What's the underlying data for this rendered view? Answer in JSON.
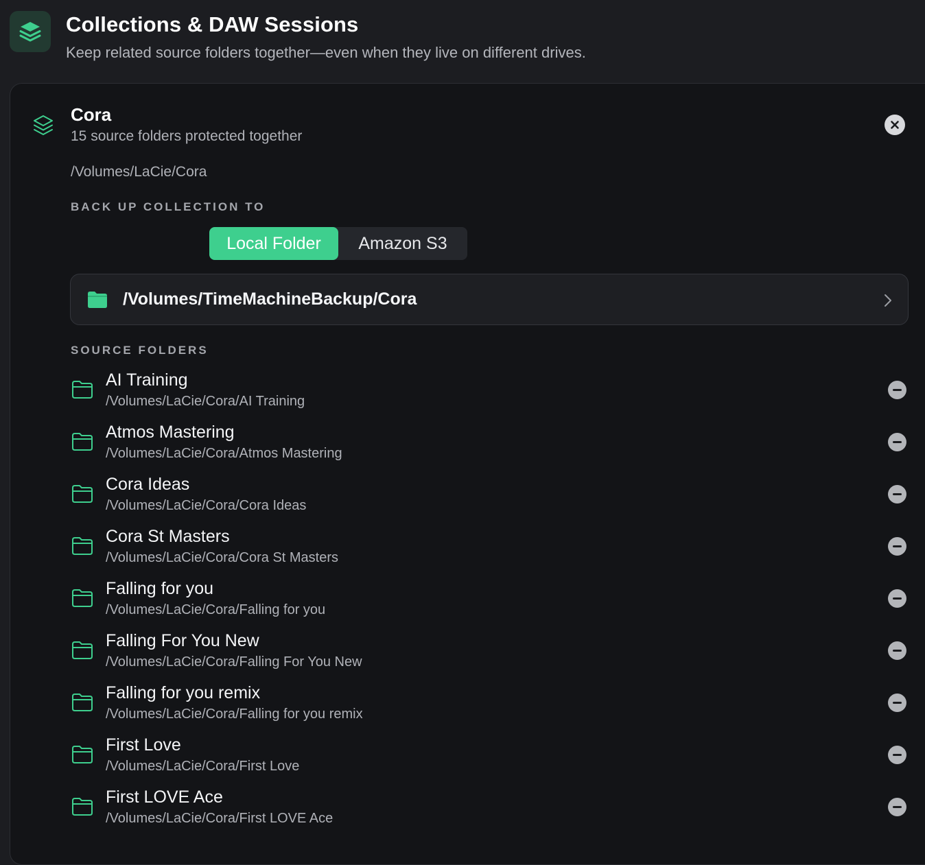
{
  "header": {
    "icon": "layers-icon",
    "title": "Collections & DAW Sessions",
    "subtitle": "Keep related source folders together—even when they live on different drives."
  },
  "collection": {
    "icon": "layers-icon",
    "name": "Cora",
    "count_text": "15 source folders protected together",
    "path": "/Volumes/LaCie/Cora",
    "close_icon": "close-icon",
    "backup_label": "BACK UP COLLECTION TO",
    "backup_options": [
      "Local Folder",
      "Amazon S3"
    ],
    "backup_selected": "Local Folder",
    "destination": {
      "icon": "folder-filled-icon",
      "path": "/Volumes/TimeMachineBackup/Cora",
      "chevron_icon": "chevron-right-icon"
    },
    "sources_label": "SOURCE FOLDERS",
    "sources": [
      {
        "name": "AI Training",
        "path": "/Volumes/LaCie/Cora/AI Training"
      },
      {
        "name": "Atmos Mastering",
        "path": "/Volumes/LaCie/Cora/Atmos Mastering"
      },
      {
        "name": "Cora Ideas",
        "path": "/Volumes/LaCie/Cora/Cora Ideas"
      },
      {
        "name": "Cora St Masters",
        "path": "/Volumes/LaCie/Cora/Cora St Masters"
      },
      {
        "name": "Falling for you",
        "path": "/Volumes/LaCie/Cora/Falling for you"
      },
      {
        "name": "Falling For You New",
        "path": "/Volumes/LaCie/Cora/Falling For You New"
      },
      {
        "name": "Falling for you remix",
        "path": "/Volumes/LaCie/Cora/Falling for you remix"
      },
      {
        "name": "First Love",
        "path": "/Volumes/LaCie/Cora/First Love"
      },
      {
        "name": "First LOVE Ace",
        "path": "/Volumes/LaCie/Cora/First LOVE Ace"
      }
    ]
  },
  "colors": {
    "accent": "#3ecf8e",
    "background": "#1c1d21",
    "card": "#131417"
  }
}
